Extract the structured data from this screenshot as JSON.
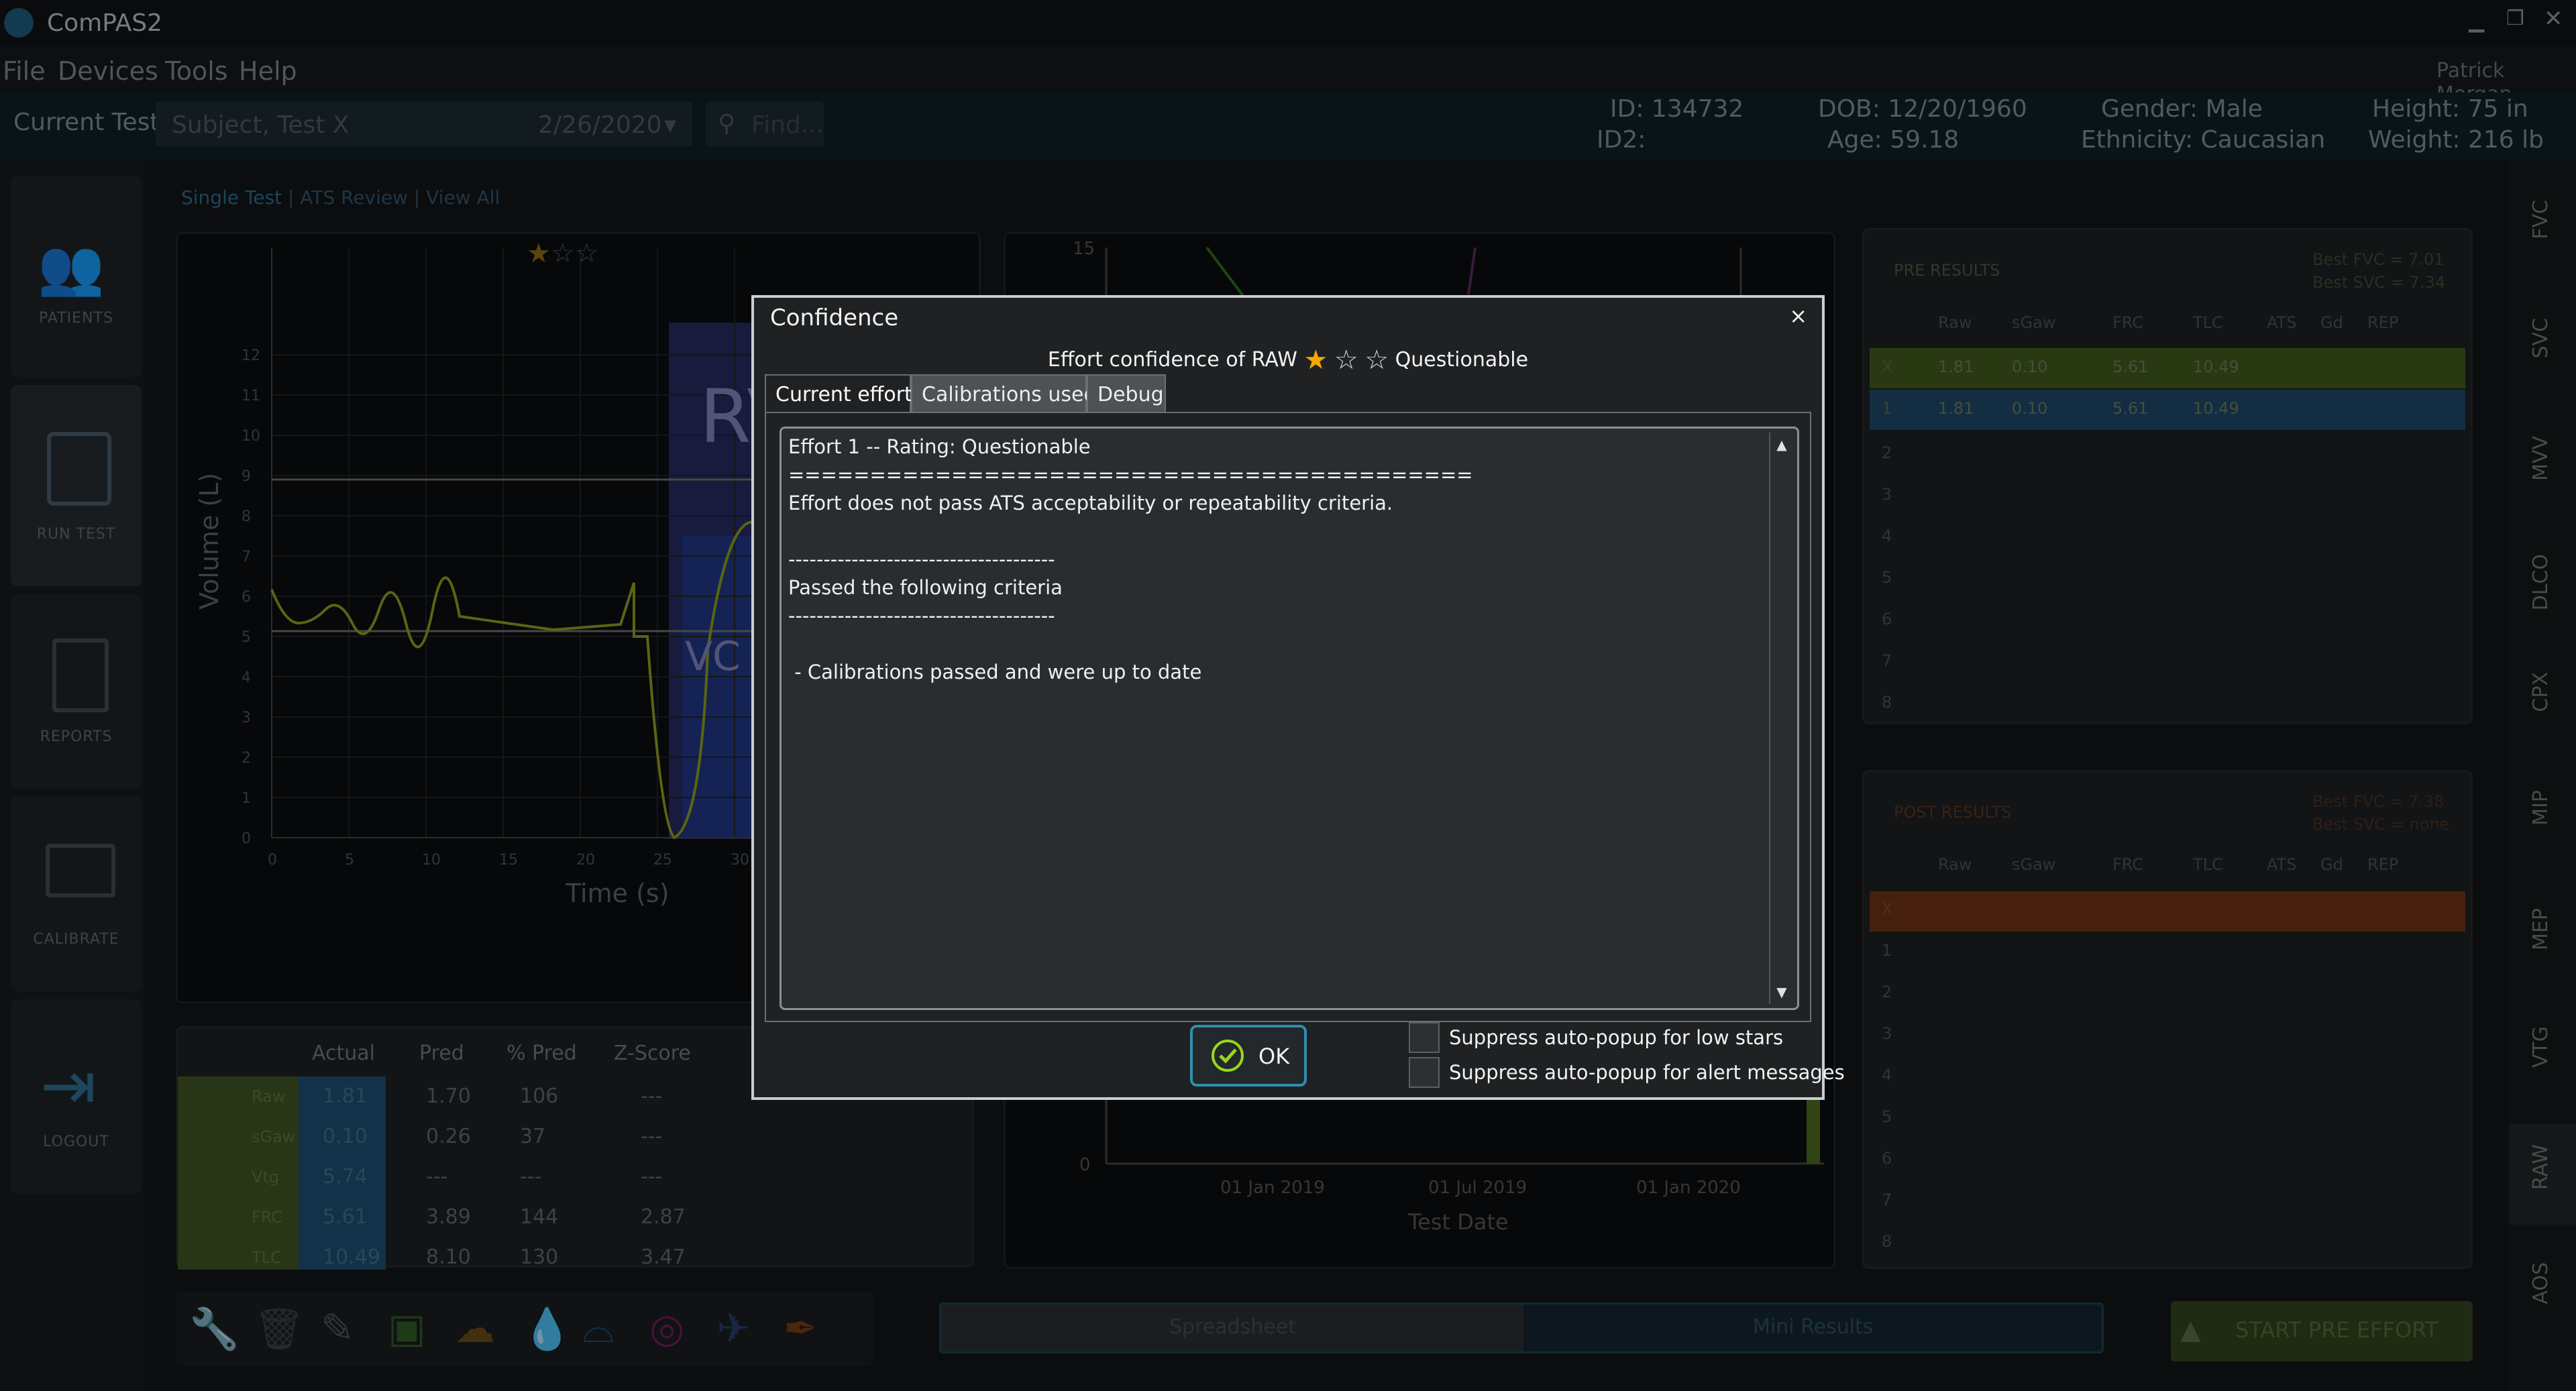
{
  "app": {
    "title": "ComPAS2",
    "menu": [
      "File",
      "Devices",
      "Tools",
      "Help"
    ],
    "user": "Patrick Morgan"
  },
  "header": {
    "current_test_label": "Current Test:",
    "test_select_value": "Subject, Test X",
    "test_select_date": "2/26/2020",
    "find_placeholder": "Find...",
    "id": "ID: 134732",
    "id2": "ID2:",
    "dob": "DOB: 12/20/1960",
    "age": "Age: 59.18",
    "gender": "Gender: Male",
    "ethnicity": "Ethnicity: Caucasian",
    "height": "Height: 75 in",
    "weight": "Weight: 216 lb"
  },
  "nav": {
    "items": [
      "PATIENTS",
      "RUN TEST",
      "REPORTS",
      "CALIBRATE",
      "LOGOUT"
    ]
  },
  "view_links": [
    "Single Test",
    "ATS Review",
    "View All"
  ],
  "main_chart": {
    "ylabel": "Volume (L)",
    "xlabel": "Time (s)",
    "yticks": [
      "0",
      "1",
      "2",
      "3",
      "4",
      "5",
      "6",
      "7",
      "8",
      "9",
      "10",
      "11",
      "12"
    ],
    "xticks": [
      "0",
      "5",
      "10",
      "15",
      "20",
      "25",
      "30"
    ],
    "labels": [
      "RV",
      "VC"
    ]
  },
  "trend_chart": {
    "xlabel": "Test Date",
    "xticks": [
      "01 Jan 2019",
      "01 Jul 2019",
      "01 Jan 2020"
    ],
    "yticks": [
      "15",
      "0"
    ]
  },
  "results_table": {
    "headers": [
      "Actual",
      "Pred",
      "% Pred",
      "Z-Score"
    ],
    "rows": [
      {
        "name": "Raw",
        "values": [
          "1.81",
          "1.70",
          "106",
          "---"
        ]
      },
      {
        "name": "sGaw",
        "values": [
          "0.10",
          "0.26",
          "37",
          "---"
        ]
      },
      {
        "name": "Vtg",
        "values": [
          "5.74",
          "---",
          "---",
          "---"
        ]
      },
      {
        "name": "FRC",
        "values": [
          "5.61",
          "3.89",
          "144",
          "2.87"
        ]
      },
      {
        "name": "TLC",
        "values": [
          "10.49",
          "8.10",
          "130",
          "3.47"
        ]
      }
    ]
  },
  "pre_results": {
    "title": "PRE RESULTS",
    "best_fvc": "Best FVC = 7.01",
    "best_svc": "Best SVC = 7.34",
    "headers": [
      "Raw",
      "sGaw",
      "FRC",
      "TLC",
      "ATS",
      "Gd",
      "REP"
    ],
    "rows": [
      {
        "index": "X",
        "values": [
          "1.81",
          "0.10",
          "5.61",
          "10.49"
        ]
      },
      {
        "index": "1",
        "values": [
          "1.81",
          "0.10",
          "5.61",
          "10.49"
        ]
      }
    ],
    "empty_rows": [
      "2",
      "3",
      "4",
      "5",
      "6",
      "7",
      "8"
    ]
  },
  "post_results": {
    "title": "POST RESULTS",
    "best_fvc": "Best FVC = 7.38",
    "best_svc": "Best SVC = none",
    "headers": [
      "Raw",
      "sGaw",
      "FRC",
      "TLC",
      "ATS",
      "Gd",
      "REP"
    ],
    "rows": [
      "X",
      "1",
      "2",
      "3",
      "4",
      "5",
      "6",
      "7",
      "8"
    ]
  },
  "right_tabs": [
    "FVC",
    "SVC",
    "MVV",
    "DLCO",
    "CPX",
    "MIP",
    "MEP",
    "VTG",
    "RAW",
    "AOS"
  ],
  "bottom_bar": {
    "spreadsheet": "Spreadsheet",
    "mini_results": "Mini Results",
    "start_button": "START PRE EFFORT"
  },
  "dialog": {
    "title": "Confidence",
    "close": "×",
    "subtitle_prefix": "Effort confidence of RAW",
    "subtitle_suffix": "Questionable",
    "stars": {
      "filled": 1,
      "total": 3
    },
    "tabs": [
      "Current effort",
      "Calibrations used",
      "Debug"
    ],
    "active_tab": "Current effort",
    "content_lines": [
      "Effort 1 -- Rating: Questionable",
      "==========================================",
      "Effort does not pass ATS acceptability or repeatability criteria.",
      "",
      "--------------------------------------",
      "Passed the following criteria",
      "--------------------------------------",
      "",
      " - Calibrations passed and were up to date"
    ],
    "ok_label": "OK",
    "checkboxes": [
      {
        "label": "Suppress auto-popup for low stars",
        "checked": false
      },
      {
        "label": "Suppress auto-popup for alert messages",
        "checked": false
      }
    ]
  },
  "colors": {
    "accent_blue": "#2e8fb0",
    "ok_green": "#9ad61a",
    "star_gold": "#f5a800",
    "row_green": "#5d7a2e",
    "row_blue": "#245f8a",
    "row_orange": "#b8561c"
  }
}
